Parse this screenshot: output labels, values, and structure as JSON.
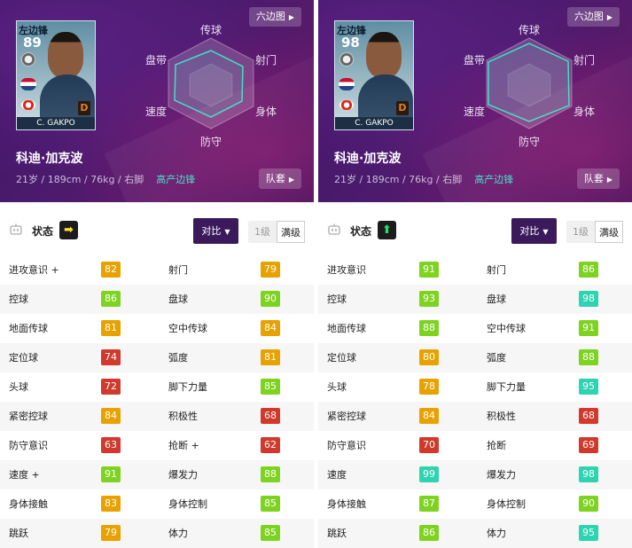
{
  "panels": [
    {
      "card": {
        "position": "左边锋",
        "overall": "89",
        "grade": "D",
        "name": "C. GAKPO"
      },
      "radar": {
        "top": "传球",
        "top_left": "盘带",
        "top_right": "射门",
        "bottom_left": "速度",
        "bottom_right": "身体",
        "bottom": "防守"
      },
      "hex_button": "六边图",
      "player_name": "科迪·加克波",
      "player_info": "21岁 / 189cm / 76kg / 右脚",
      "playstyle": "高产边锋",
      "kit_button": "队套",
      "status_label": "状态",
      "status_arrow": "➡",
      "compare_button": "对比",
      "level_options": [
        "1级",
        "满级"
      ],
      "stats": [
        {
          "l_name": "进攻意识 +",
          "l_val": "82",
          "l_col": "#e8a200",
          "r_name": "射门",
          "r_val": "79",
          "r_col": "#e8a200"
        },
        {
          "l_name": "控球",
          "l_val": "86",
          "l_col": "#7ed321",
          "r_name": "盘球",
          "r_val": "90",
          "r_col": "#7ed321"
        },
        {
          "l_name": "地面传球",
          "l_val": "81",
          "l_col": "#e8a200",
          "r_name": "空中传球",
          "r_val": "84",
          "r_col": "#e8a200"
        },
        {
          "l_name": "定位球",
          "l_val": "74",
          "l_col": "#d0392b",
          "r_name": "弧度",
          "r_val": "81",
          "r_col": "#e8a200"
        },
        {
          "l_name": "头球",
          "l_val": "72",
          "l_col": "#d0392b",
          "r_name": "脚下力量",
          "r_val": "85",
          "r_col": "#7ed321"
        },
        {
          "l_name": "紧密控球",
          "l_val": "84",
          "l_col": "#e8a200",
          "r_name": "积极性",
          "r_val": "68",
          "r_col": "#d0392b"
        },
        {
          "l_name": "防守意识",
          "l_val": "63",
          "l_col": "#d0392b",
          "r_name": "抢断 +",
          "r_val": "62",
          "r_col": "#d0392b"
        },
        {
          "l_name": "速度 +",
          "l_val": "91",
          "l_col": "#7ed321",
          "r_name": "爆发力",
          "r_val": "88",
          "r_col": "#7ed321"
        },
        {
          "l_name": "身体接触",
          "l_val": "83",
          "l_col": "#e8a200",
          "r_name": "身体控制",
          "r_val": "85",
          "r_col": "#7ed321"
        },
        {
          "l_name": "跳跃",
          "l_val": "79",
          "l_col": "#e8a200",
          "r_name": "体力",
          "r_val": "85",
          "r_col": "#7ed321"
        }
      ]
    },
    {
      "card": {
        "position": "左边锋",
        "overall": "98",
        "grade": "D",
        "name": "C. GAKPO"
      },
      "radar": {
        "top": "传球",
        "top_left": "盘带",
        "top_right": "射门",
        "bottom_left": "速度",
        "bottom_right": "身体",
        "bottom": "防守"
      },
      "hex_button": "六边图",
      "player_name": "科迪·加克波",
      "player_info": "21岁 / 189cm / 76kg / 右脚",
      "playstyle": "高产边锋",
      "kit_button": "队套",
      "status_label": "状态",
      "status_arrow": "⬆",
      "compare_button": "对比",
      "level_options": [
        "1级",
        "满级"
      ],
      "stats": [
        {
          "l_name": "进攻意识",
          "l_val": "91",
          "l_col": "#7ed321",
          "r_name": "射门",
          "r_val": "86",
          "r_col": "#7ed321"
        },
        {
          "l_name": "控球",
          "l_val": "93",
          "l_col": "#7ed321",
          "r_name": "盘球",
          "r_val": "98",
          "r_col": "#2ed3b0"
        },
        {
          "l_name": "地面传球",
          "l_val": "88",
          "l_col": "#7ed321",
          "r_name": "空中传球",
          "r_val": "91",
          "r_col": "#7ed321"
        },
        {
          "l_name": "定位球",
          "l_val": "80",
          "l_col": "#e8a200",
          "r_name": "弧度",
          "r_val": "88",
          "r_col": "#7ed321"
        },
        {
          "l_name": "头球",
          "l_val": "78",
          "l_col": "#e8a200",
          "r_name": "脚下力量",
          "r_val": "95",
          "r_col": "#2ed3b0"
        },
        {
          "l_name": "紧密控球",
          "l_val": "84",
          "l_col": "#e8a200",
          "r_name": "积极性",
          "r_val": "68",
          "r_col": "#d0392b"
        },
        {
          "l_name": "防守意识",
          "l_val": "70",
          "l_col": "#d0392b",
          "r_name": "抢断",
          "r_val": "69",
          "r_col": "#d0392b"
        },
        {
          "l_name": "速度",
          "l_val": "99",
          "l_col": "#2ed3b0",
          "r_name": "爆发力",
          "r_val": "98",
          "r_col": "#2ed3b0"
        },
        {
          "l_name": "身体接触",
          "l_val": "87",
          "l_col": "#7ed321",
          "r_name": "身体控制",
          "r_val": "90",
          "r_col": "#7ed321"
        },
        {
          "l_name": "跳跃",
          "l_val": "86",
          "l_col": "#7ed321",
          "r_name": "体力",
          "r_val": "95",
          "r_col": "#2ed3b0"
        }
      ]
    }
  ]
}
